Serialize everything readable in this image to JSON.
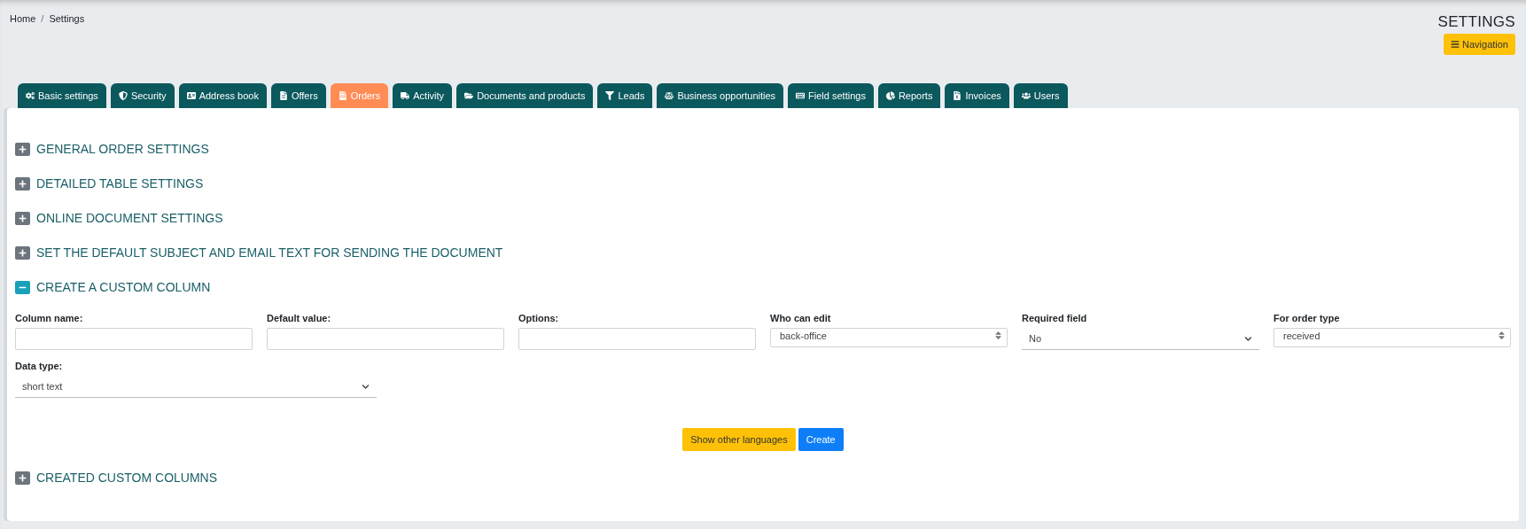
{
  "breadcrumb": [
    "Home",
    "Settings"
  ],
  "breadcrumb_separator": "/",
  "page_title": "SETTINGS",
  "navigation_button": "Navigation",
  "tabs": [
    {
      "label": "Basic settings",
      "selected": false
    },
    {
      "label": "Security",
      "selected": false
    },
    {
      "label": "Address book",
      "selected": false
    },
    {
      "label": "Offers",
      "selected": false
    },
    {
      "label": "Orders",
      "selected": true
    },
    {
      "label": "Activity",
      "selected": false
    },
    {
      "label": "Documents and products",
      "selected": false
    },
    {
      "label": "Leads",
      "selected": false
    },
    {
      "label": "Business opportunities",
      "selected": false
    },
    {
      "label": "Field settings",
      "selected": false
    },
    {
      "label": "Reports",
      "selected": false
    },
    {
      "label": "Invoices",
      "selected": false
    },
    {
      "label": "Users",
      "selected": false
    }
  ],
  "sections": [
    {
      "title": "GENERAL ORDER SETTINGS",
      "expanded": false
    },
    {
      "title": "DETAILED TABLE SETTINGS",
      "expanded": false
    },
    {
      "title": "ONLINE DOCUMENT SETTINGS",
      "expanded": false
    },
    {
      "title": "SET THE DEFAULT SUBJECT AND EMAIL TEXT FOR SENDING THE DOCUMENT",
      "expanded": false
    },
    {
      "title": "CREATE A CUSTOM COLUMN",
      "expanded": true,
      "form": {
        "fields": [
          {
            "kind": "text",
            "label": "Column name:"
          },
          {
            "kind": "text",
            "label": "Default value:"
          },
          {
            "kind": "text",
            "label": "Options:"
          },
          {
            "kind": "multiselect",
            "label": "Who can edit",
            "value": "back-office"
          },
          {
            "kind": "select",
            "label": "Required field",
            "value": "No"
          },
          {
            "kind": "multiselect",
            "label": "For order type",
            "value": "received"
          },
          {
            "kind": "select",
            "label": "Data type:",
            "value": "short text"
          }
        ],
        "buttons": [
          {
            "kind": "secondary",
            "label": "Show other languages"
          },
          {
            "kind": "primary",
            "label": "Create"
          }
        ]
      }
    },
    {
      "title": "CREATED CUSTOM COLUMNS",
      "expanded": false
    }
  ]
}
